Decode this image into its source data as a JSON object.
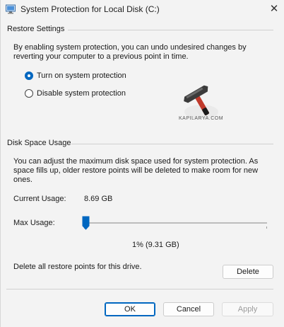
{
  "window": {
    "title": "System Protection for Local Disk (C:)",
    "close_glyph": "✕"
  },
  "restore_settings": {
    "group_label": "Restore Settings",
    "description_line1": "By enabling system protection, you can undo undesired changes by",
    "description_line2": "reverting your computer to a previous point in time.",
    "options": [
      {
        "label": "Turn on system protection",
        "checked": true
      },
      {
        "label": "Disable system protection",
        "checked": false
      }
    ]
  },
  "watermark": {
    "text": "KAPILARYA.COM",
    "icon": "hammer-icon"
  },
  "disk_space": {
    "group_label": "Disk Space Usage",
    "description_line1": "You can adjust the maximum disk space used for system protection. As",
    "description_line2": "space fills up, older restore points will be deleted to make room for new",
    "description_line3": "ones.",
    "current_usage_label": "Current Usage:",
    "current_usage_value": "8.69 GB",
    "max_usage_label": "Max Usage:",
    "max_usage_percent": 1,
    "max_usage_readout": "1% (9.31 GB)",
    "delete_text": "Delete all restore points for this drive.",
    "delete_button": "Delete"
  },
  "footer": {
    "ok": "OK",
    "cancel": "Cancel",
    "apply": "Apply"
  },
  "colors": {
    "accent": "#0067c0",
    "background": "#f3f3f3"
  }
}
